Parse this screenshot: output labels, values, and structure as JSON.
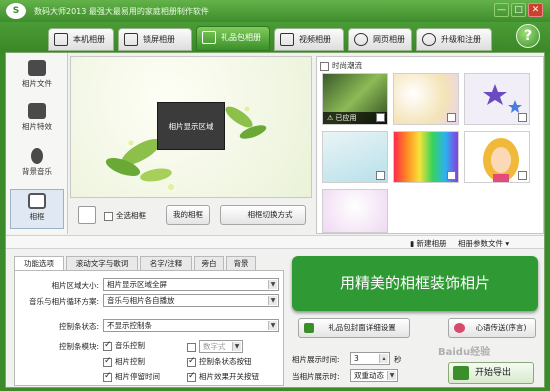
{
  "app": {
    "title": "数码大师2013 最强大最易用的家庭相册制作软件",
    "logo": "S"
  },
  "window": {
    "minimize": "—",
    "maximize": "□",
    "close": "✕"
  },
  "tabs": [
    {
      "label": "本机相册"
    },
    {
      "label": "锁屏相册"
    },
    {
      "label": "礼品包相册"
    },
    {
      "label": "视频相册"
    },
    {
      "label": "网页相册"
    },
    {
      "label": "升级和注册"
    }
  ],
  "help": "?",
  "sidebar": {
    "items": [
      {
        "label": "相片文件"
      },
      {
        "label": "相片特效"
      },
      {
        "label": "背景音乐"
      },
      {
        "label": "相框"
      }
    ]
  },
  "canvas": {
    "photo_area": "相片显示区域"
  },
  "canvas_controls": {
    "select_all": "全选相框",
    "my_frames": "我的相框",
    "switch_mode": "相框切换方式"
  },
  "frames": {
    "category": "时尚潮流",
    "applied_label": "已应用"
  },
  "strip": {
    "new_album": "新建相册",
    "album_settings": "相册参数文件"
  },
  "settings": {
    "tabs": [
      "功能选项",
      "滚动文字与歌词",
      "名字/注释",
      "旁白",
      "背景"
    ],
    "area_size": {
      "label": "相片区域大小:",
      "value": "相片显示区域全屏"
    },
    "music_mode": {
      "label": "音乐与相片循环方案:",
      "value": "音乐与相片各自播放"
    },
    "control_state": {
      "label": "控制条状态:",
      "value": "不显示控制条"
    },
    "control_module": {
      "label": "控制条模块:"
    },
    "options": [
      {
        "label": "音乐控制",
        "checked": true
      },
      {
        "label": "数字式",
        "checked": false
      },
      {
        "label": "相片控制",
        "checked": true
      },
      {
        "label": "控制条状态按钮",
        "checked": true
      },
      {
        "label": "相片停留时间",
        "checked": true
      },
      {
        "label": "相片效果开关按钮",
        "checked": true
      }
    ]
  },
  "right": {
    "banner": "用精美的相框装饰相片",
    "gift_button": "礼品包封面详细设置",
    "blessing": "心语传送(序言)",
    "photo_time": {
      "label": "相片展示时间:",
      "value": "3",
      "unit": "秒"
    },
    "current_show": {
      "label": "当相片展示时:",
      "value": "双重动态"
    },
    "export": "开始导出"
  },
  "watermark": "Baidu经验"
}
